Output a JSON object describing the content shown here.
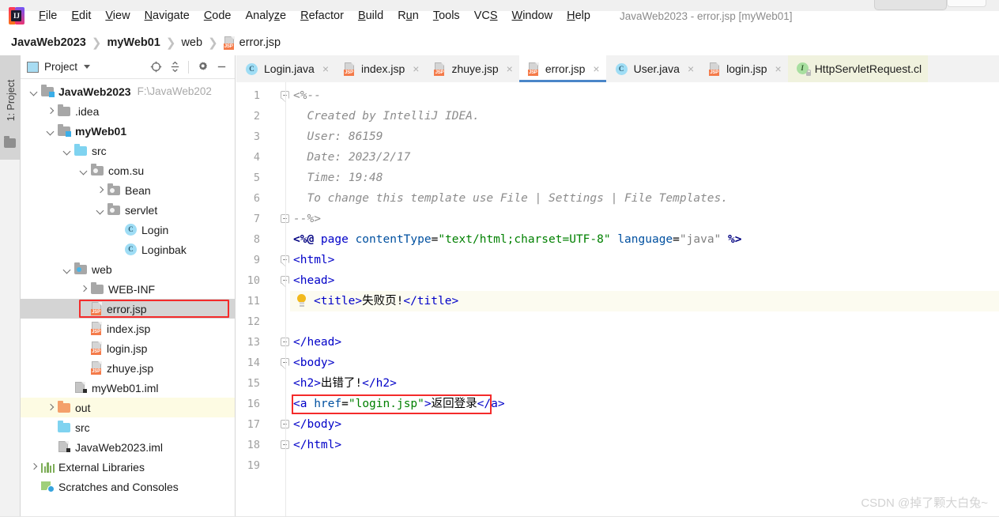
{
  "window": {
    "title": "JavaWeb2023 - error.jsp [myWeb01]",
    "app_logo_letters": "IJ"
  },
  "menu": {
    "items": [
      {
        "label": "File",
        "mnemonic": "F"
      },
      {
        "label": "Edit",
        "mnemonic": "E"
      },
      {
        "label": "View",
        "mnemonic": "V"
      },
      {
        "label": "Navigate",
        "mnemonic": "N"
      },
      {
        "label": "Code",
        "mnemonic": "C"
      },
      {
        "label": "Analyze",
        "mnemonic": "z"
      },
      {
        "label": "Refactor",
        "mnemonic": "R"
      },
      {
        "label": "Build",
        "mnemonic": "B"
      },
      {
        "label": "Run",
        "mnemonic": "u"
      },
      {
        "label": "Tools",
        "mnemonic": "T"
      },
      {
        "label": "VCS",
        "mnemonic": "S"
      },
      {
        "label": "Window",
        "mnemonic": "W"
      },
      {
        "label": "Help",
        "mnemonic": "H"
      }
    ]
  },
  "breadcrumb": {
    "items": [
      {
        "label": "JavaWeb2023",
        "bold": true,
        "icon": ""
      },
      {
        "label": "myWeb01",
        "bold": true,
        "icon": ""
      },
      {
        "label": "web",
        "bold": false,
        "icon": ""
      },
      {
        "label": "error.jsp",
        "bold": false,
        "icon": "jsp-file-icon"
      }
    ],
    "separator": "❯"
  },
  "toolstrip": {
    "label": "1: Project",
    "folder_icon": "folder-icon"
  },
  "project_panel": {
    "title": "Project",
    "view_mode_caret": "chevron-down-icon",
    "tools": [
      {
        "name": "locate-in-tree-icon"
      },
      {
        "name": "collapse-all-icon"
      },
      {
        "name": "gear-settings-icon"
      },
      {
        "name": "minimize-panel-icon"
      }
    ],
    "tree": [
      {
        "label": "JavaWeb2023",
        "path": "F:\\JavaWeb202",
        "depth": 0,
        "arrow": "down",
        "icon": "module-folder-icon",
        "bold": true,
        "state": ""
      },
      {
        "label": ".idea",
        "path": "",
        "depth": 1,
        "arrow": "right",
        "icon": "grey-folder-icon",
        "bold": false,
        "state": ""
      },
      {
        "label": "myWeb01",
        "path": "",
        "depth": 1,
        "arrow": "down",
        "icon": "module-folder-icon",
        "bold": true,
        "state": ""
      },
      {
        "label": "src",
        "path": "",
        "depth": 2,
        "arrow": "down",
        "icon": "source-folder-icon",
        "bold": false,
        "state": ""
      },
      {
        "label": "com.su",
        "path": "",
        "depth": 3,
        "arrow": "down",
        "icon": "package-icon",
        "bold": false,
        "state": ""
      },
      {
        "label": "Bean",
        "path": "",
        "depth": 4,
        "arrow": "right",
        "icon": "package-icon",
        "bold": false,
        "state": ""
      },
      {
        "label": "servlet",
        "path": "",
        "depth": 4,
        "arrow": "down",
        "icon": "package-icon",
        "bold": false,
        "state": ""
      },
      {
        "label": "Login",
        "path": "",
        "depth": 5,
        "arrow": "none",
        "icon": "java-class-icon",
        "bold": false,
        "state": ""
      },
      {
        "label": "Loginbak",
        "path": "",
        "depth": 5,
        "arrow": "none",
        "icon": "java-class-icon",
        "bold": false,
        "state": ""
      },
      {
        "label": "web",
        "path": "",
        "depth": 2,
        "arrow": "down",
        "icon": "web-folder-icon",
        "bold": false,
        "state": ""
      },
      {
        "label": "WEB-INF",
        "path": "",
        "depth": 3,
        "arrow": "right",
        "icon": "grey-folder-icon",
        "bold": false,
        "state": ""
      },
      {
        "label": "error.jsp",
        "path": "",
        "depth": 3,
        "arrow": "none",
        "icon": "jsp-file-icon",
        "bold": false,
        "state": "selected"
      },
      {
        "label": "index.jsp",
        "path": "",
        "depth": 3,
        "arrow": "none",
        "icon": "jsp-file-icon",
        "bold": false,
        "state": ""
      },
      {
        "label": "login.jsp",
        "path": "",
        "depth": 3,
        "arrow": "none",
        "icon": "jsp-file-icon",
        "bold": false,
        "state": ""
      },
      {
        "label": "zhuye.jsp",
        "path": "",
        "depth": 3,
        "arrow": "none",
        "icon": "jsp-file-icon",
        "bold": false,
        "state": ""
      },
      {
        "label": "myWeb01.iml",
        "path": "",
        "depth": 2,
        "arrow": "none",
        "icon": "iml-file-icon",
        "bold": false,
        "state": ""
      },
      {
        "label": "out",
        "path": "",
        "depth": 1,
        "arrow": "right",
        "icon": "excluded-folder-icon",
        "bold": false,
        "state": "excluded"
      },
      {
        "label": "src",
        "path": "",
        "depth": 1,
        "arrow": "none",
        "icon": "source-folder-icon",
        "bold": false,
        "state": ""
      },
      {
        "label": "JavaWeb2023.iml",
        "path": "",
        "depth": 1,
        "arrow": "none",
        "icon": "iml-file-icon",
        "bold": false,
        "state": ""
      },
      {
        "label": "External Libraries",
        "path": "",
        "depth": 0,
        "arrow": "right",
        "icon": "libraries-icon",
        "bold": false,
        "state": ""
      },
      {
        "label": "Scratches and Consoles",
        "path": "",
        "depth": 0,
        "arrow": "none",
        "icon": "scratches-icon",
        "bold": false,
        "state": ""
      }
    ]
  },
  "editor_tabs": [
    {
      "label": "Login.java",
      "icon": "java-class-icon",
      "active": false,
      "closable": true,
      "library": false
    },
    {
      "label": "index.jsp",
      "icon": "jsp-file-icon",
      "active": false,
      "closable": true,
      "library": false
    },
    {
      "label": "zhuye.jsp",
      "icon": "jsp-file-icon",
      "active": false,
      "closable": true,
      "library": false
    },
    {
      "label": "error.jsp",
      "icon": "jsp-file-icon",
      "active": true,
      "closable": true,
      "library": false
    },
    {
      "label": "User.java",
      "icon": "java-class-icon",
      "active": false,
      "closable": true,
      "library": false
    },
    {
      "label": "login.jsp",
      "icon": "jsp-file-icon",
      "active": false,
      "closable": true,
      "library": false
    },
    {
      "label": "HttpServletRequest.cl",
      "icon": "java-interface-icon",
      "active": false,
      "closable": false,
      "library": true
    }
  ],
  "tab_close_glyph": "×",
  "editor": {
    "filename": "error.jsp",
    "total_lines": 19,
    "highlighted_line": 11,
    "intention_bulb_line": 11,
    "red_boxed_line": 16,
    "lines": [
      {
        "n": 1,
        "fold": "open",
        "indent": 0,
        "tokens": [
          {
            "t": "<%--",
            "c": "k-cmt"
          }
        ]
      },
      {
        "n": 2,
        "fold": "",
        "indent": 0,
        "tokens": [
          {
            "t": "  Created by IntelliJ IDEA.",
            "c": "k-cmt"
          }
        ]
      },
      {
        "n": 3,
        "fold": "",
        "indent": 0,
        "tokens": [
          {
            "t": "  User: 86159",
            "c": "k-cmt"
          }
        ]
      },
      {
        "n": 4,
        "fold": "",
        "indent": 0,
        "tokens": [
          {
            "t": "  Date: 2023/2/17",
            "c": "k-cmt"
          }
        ]
      },
      {
        "n": 5,
        "fold": "",
        "indent": 0,
        "tokens": [
          {
            "t": "  Time: 19:48",
            "c": "k-cmt"
          }
        ]
      },
      {
        "n": 6,
        "fold": "",
        "indent": 0,
        "tokens": [
          {
            "t": "  To change this template use File | Settings | File Templates.",
            "c": "k-cmt"
          }
        ]
      },
      {
        "n": 7,
        "fold": "close",
        "indent": 0,
        "tokens": [
          {
            "t": "--%>",
            "c": "k-cmt"
          }
        ]
      },
      {
        "n": 8,
        "fold": "",
        "indent": 0,
        "tokens": [
          {
            "t": "<%@ ",
            "c": "k-jsp"
          },
          {
            "t": "page ",
            "c": "k-tag"
          },
          {
            "t": "contentType",
            "c": "k-attr"
          },
          {
            "t": "=",
            "c": "k-txt"
          },
          {
            "t": "\"text/html;charset=UTF-8\"",
            "c": "k-str"
          },
          {
            "t": " ",
            "c": "k-txt"
          },
          {
            "t": "language",
            "c": "k-attr"
          },
          {
            "t": "=",
            "c": "k-txt"
          },
          {
            "t": "\"java\"",
            "c": "k-gray"
          },
          {
            "t": " %>",
            "c": "k-jsp"
          }
        ]
      },
      {
        "n": 9,
        "fold": "open",
        "indent": 0,
        "tokens": [
          {
            "t": "<html>",
            "c": "k-tag"
          }
        ]
      },
      {
        "n": 10,
        "fold": "open",
        "indent": 0,
        "tokens": [
          {
            "t": "<head>",
            "c": "k-tag"
          }
        ]
      },
      {
        "n": 11,
        "fold": "",
        "indent": 1,
        "tokens": [
          {
            "t": "<title>",
            "c": "k-tag"
          },
          {
            "t": "失败页!",
            "c": "k-txt"
          },
          {
            "t": "</title>",
            "c": "k-tag"
          }
        ]
      },
      {
        "n": 12,
        "fold": "",
        "indent": 0,
        "tokens": []
      },
      {
        "n": 13,
        "fold": "close",
        "indent": 0,
        "tokens": [
          {
            "t": "</head>",
            "c": "k-tag"
          }
        ]
      },
      {
        "n": 14,
        "fold": "open",
        "indent": 0,
        "tokens": [
          {
            "t": "<body>",
            "c": "k-tag"
          }
        ]
      },
      {
        "n": 15,
        "fold": "",
        "indent": 0,
        "tokens": [
          {
            "t": "<h2>",
            "c": "k-tag"
          },
          {
            "t": "出错了!",
            "c": "k-txt"
          },
          {
            "t": "</h2>",
            "c": "k-tag"
          }
        ]
      },
      {
        "n": 16,
        "fold": "",
        "indent": 0,
        "tokens": [
          {
            "t": "<a ",
            "c": "k-tag"
          },
          {
            "t": "href",
            "c": "k-attr"
          },
          {
            "t": "=",
            "c": "k-txt"
          },
          {
            "t": "\"login.jsp\"",
            "c": "k-str"
          },
          {
            "t": ">",
            "c": "k-tag"
          },
          {
            "t": "返回登录",
            "c": "k-txt"
          },
          {
            "t": "</a>",
            "c": "k-tag"
          }
        ]
      },
      {
        "n": 17,
        "fold": "close",
        "indent": 0,
        "tokens": [
          {
            "t": "</body>",
            "c": "k-tag"
          }
        ]
      },
      {
        "n": 18,
        "fold": "close",
        "indent": 0,
        "tokens": [
          {
            "t": "</html>",
            "c": "k-tag"
          }
        ]
      },
      {
        "n": 19,
        "fold": "",
        "indent": 0,
        "tokens": []
      }
    ]
  },
  "watermark": "CSDN @掉了颗大白兔~",
  "colors": {
    "accent_blue": "#4a86c8",
    "highlight_red": "#f42b2b",
    "selection_grey": "#d4d4d4",
    "excluded_yellow": "#fdfbe3",
    "tag_blue": "#0000c8",
    "string_green": "#008000",
    "comment_grey": "#8c8c8c",
    "jsp_navy": "#000080"
  }
}
